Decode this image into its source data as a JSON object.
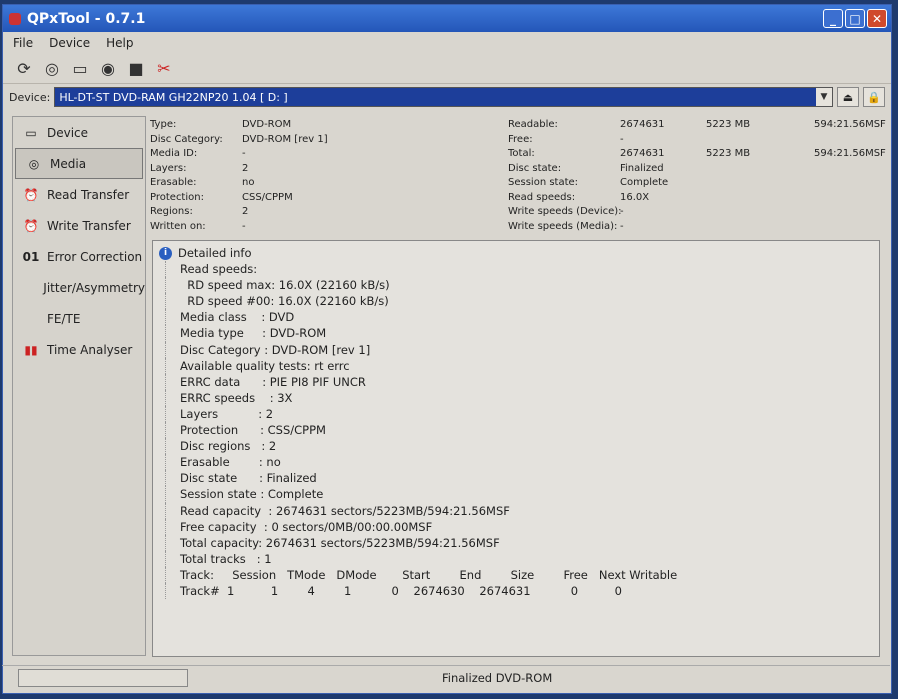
{
  "title": "QPxTool - 0.7.1",
  "menu": [
    "File",
    "Device",
    "Help"
  ],
  "device": {
    "label": "Device:",
    "value": "HL-DT-ST DVD-RAM GH22NP20 1.04 [ D: ]"
  },
  "sidebar": [
    {
      "label": "Device",
      "icon": "disc-drive-icon"
    },
    {
      "label": "Media",
      "icon": "disc-icon"
    },
    {
      "label": "Read Transfer",
      "icon": "clock-icon"
    },
    {
      "label": "Write Transfer",
      "icon": "clock-icon"
    },
    {
      "label": "Error Correction",
      "icon": "01-icon",
      "glyph": "01"
    },
    {
      "label": "Jitter/Asymmetry"
    },
    {
      "label": "FE/TE"
    },
    {
      "label": "Time Analyser",
      "icon": "bar-chart-icon"
    }
  ],
  "info_left": [
    [
      "Type:",
      "DVD-ROM"
    ],
    [
      "Disc Category:",
      "DVD-ROM [rev 1]"
    ],
    [
      "Media ID:",
      "-"
    ],
    [
      "Layers:",
      "2"
    ],
    [
      "Erasable:",
      "no"
    ],
    [
      "Protection:",
      "CSS/CPPM"
    ],
    [
      "Regions:",
      "2"
    ],
    [
      "Written on:",
      "-"
    ]
  ],
  "info_right": [
    [
      "Readable:",
      "2674631",
      "5223 MB",
      "594:21.56MSF"
    ],
    [
      "Free:",
      "-",
      "",
      ""
    ],
    [
      "Total:",
      "2674631",
      "5223 MB",
      "594:21.56MSF"
    ],
    [
      "Disc state:",
      "Finalized",
      "",
      ""
    ],
    [
      "Session state:",
      "Complete",
      "",
      ""
    ],
    [
      "Read speeds:",
      "16.0X",
      "",
      ""
    ],
    [
      "Write speeds (Device):",
      "-",
      "",
      ""
    ],
    [
      "Write speeds (Media):",
      "-",
      "",
      ""
    ]
  ],
  "detail": {
    "title": "Detailed info",
    "lines": [
      "Read speeds:",
      "  RD speed max: 16.0X (22160 kB/s)",
      "  RD speed #00: 16.0X (22160 kB/s)",
      "Media class    : DVD",
      "Media type     : DVD-ROM",
      "Disc Category : DVD-ROM [rev 1]",
      "Available quality tests: rt errc",
      "ERRC data      : PIE PI8 PIF UNCR",
      "ERRC speeds    : 3X",
      "Layers           : 2",
      "Protection      : CSS/CPPM",
      "Disc regions   : 2",
      "Erasable        : no",
      "Disc state      : Finalized",
      "Session state : Complete",
      "Read capacity  : 2674631 sectors/5223MB/594:21.56MSF",
      "Free capacity  : 0 sectors/0MB/00:00.00MSF",
      "Total capacity: 2674631 sectors/5223MB/594:21.56MSF",
      "Total tracks   : 1",
      "Track:     Session   TMode   DMode       Start        End        Size        Free   Next Writable",
      "Track#  1          1        4        1           0    2674630    2674631           0          0"
    ]
  },
  "status": "Finalized DVD-ROM"
}
